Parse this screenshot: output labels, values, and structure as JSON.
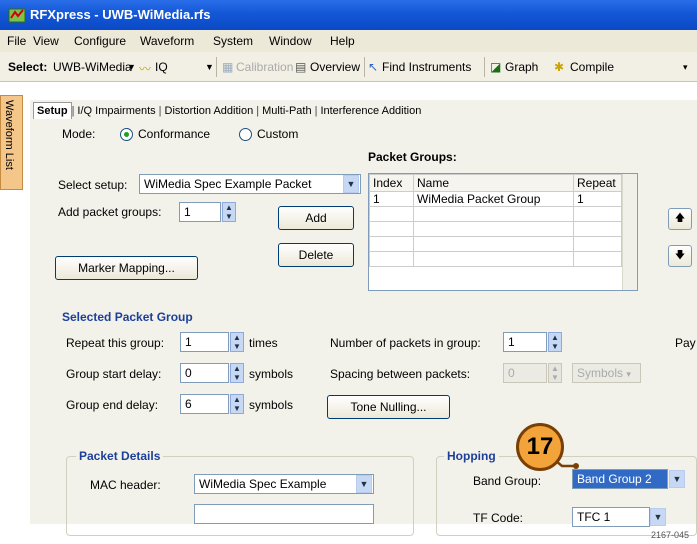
{
  "window": {
    "title": "RFXpress - UWB-WiMedia.rfs"
  },
  "menu": [
    "File",
    "View",
    "Configure",
    "Waveform",
    "System",
    "Window",
    "Help"
  ],
  "toolbar": {
    "select_label": "Select:",
    "select_value": "UWB-WiMedia",
    "iq": "IQ",
    "calibration": "Calibration",
    "overview": "Overview",
    "find_instruments": "Find Instruments",
    "graph": "Graph",
    "compile": "Compile"
  },
  "side_tab": "Waveform List",
  "tabs": [
    "Setup",
    "I/Q Impairments",
    "Distortion Addition",
    "Multi-Path",
    "Interference Addition"
  ],
  "setup": {
    "mode_label": "Mode:",
    "mode_conformance": "Conformance",
    "mode_custom": "Custom",
    "select_setup_label": "Select setup:",
    "select_setup_value": "WiMedia Spec Example Packet",
    "add_groups_label": "Add packet groups:",
    "add_groups_value": "1",
    "add_button": "Add",
    "delete_button": "Delete",
    "marker_button": "Marker Mapping..."
  },
  "packet_groups": {
    "title": "Packet Groups:",
    "columns": [
      "Index",
      "Name",
      "Repeat"
    ],
    "rows": [
      {
        "index": "1",
        "name": "WiMedia Packet Group",
        "repeat": "1"
      }
    ]
  },
  "selected_group": {
    "title": "Selected Packet Group",
    "repeat_label": "Repeat this group:",
    "repeat_value": "1",
    "repeat_unit": "times",
    "start_label": "Group start delay:",
    "start_value": "0",
    "start_unit": "symbols",
    "end_label": "Group end delay:",
    "end_value": "6",
    "end_unit": "symbols",
    "num_packets_label": "Number of packets in group:",
    "num_packets_value": "1",
    "spacing_label": "Spacing between packets:",
    "spacing_value": "0",
    "spacing_unit": "Symbols",
    "pay_label": "Pay",
    "tone_button": "Tone Nulling..."
  },
  "packet_details": {
    "title": "Packet Details",
    "mac_label": "MAC header:",
    "mac_value": "WiMedia Spec Example"
  },
  "hopping": {
    "title": "Hopping",
    "band_label": "Band Group:",
    "band_value": "Band Group 2",
    "tf_label": "TF Code:",
    "tf_value": "TFC 1"
  },
  "callout_number": "17",
  "figure_code": "2167-045"
}
